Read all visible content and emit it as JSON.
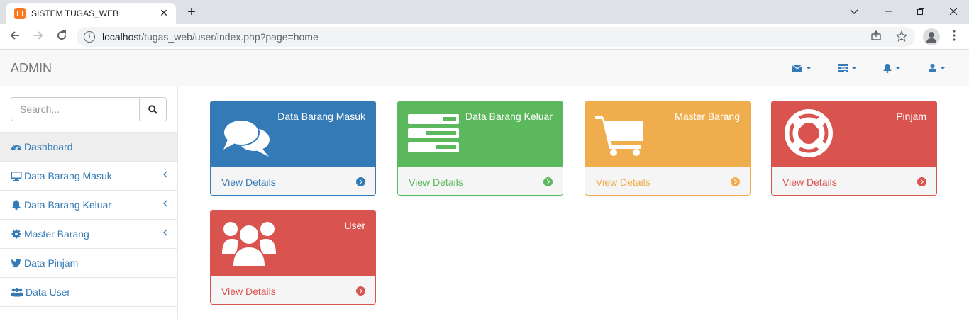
{
  "browser": {
    "tab_title": "SISTEM TUGAS_WEB",
    "tab_close": "✕",
    "new_tab": "+",
    "url_host": "localhost",
    "url_path": "/tugas_web/user/index.php?page=home"
  },
  "navbar": {
    "brand": "ADMIN",
    "menus": [
      {
        "icon": "envelope-icon"
      },
      {
        "icon": "tasks-icon"
      },
      {
        "icon": "bell-icon"
      },
      {
        "icon": "user-icon"
      }
    ]
  },
  "sidebar": {
    "search_placeholder": "Search...",
    "items": [
      {
        "label": "Dashboard",
        "icon": "dashboard-icon",
        "active": true
      },
      {
        "label": "Data Barang Masuk",
        "icon": "desktop-icon",
        "has_children": true
      },
      {
        "label": "Data Barang Keluar",
        "icon": "bell-icon",
        "has_children": true
      },
      {
        "label": "Master Barang",
        "icon": "gear-icon",
        "has_children": true
      },
      {
        "label": "Data Pinjam",
        "icon": "twitter-icon"
      },
      {
        "label": "Data User",
        "icon": "users-icon"
      }
    ]
  },
  "panels": [
    {
      "title": "Data Barang Masuk",
      "link": "View Details",
      "icon": "comments-icon",
      "color": "#337ab7"
    },
    {
      "title": "Data Barang Keluar",
      "link": "View Details",
      "icon": "tasks-icon",
      "color": "#5cb85c"
    },
    {
      "title": "Master Barang",
      "link": "View Details",
      "icon": "shopping-cart-icon",
      "color": "#f0ad4e"
    },
    {
      "title": "Pinjam",
      "link": "View Details",
      "icon": "life-ring-icon",
      "color": "#d9534f"
    },
    {
      "title": "User",
      "link": "View Details",
      "icon": "users-icon",
      "color": "#d9534f"
    }
  ]
}
